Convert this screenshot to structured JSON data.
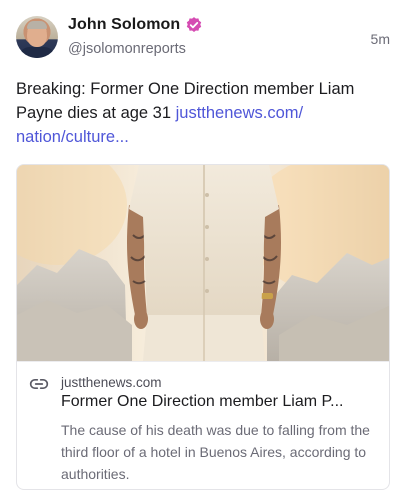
{
  "post": {
    "author_name": "John Solomon",
    "handle": "@jsolomonreports",
    "time": "5m",
    "text_prefix": "Breaking: Former One Direction member Liam Payne dies at age 31 ",
    "link_text": "justthenews.com/ nation/culture..."
  },
  "card": {
    "domain": "justthenews.com",
    "title": "Former One Direction member Liam P...",
    "description": "The cause of his death was due to falling from the third floor of a hotel in Buenos Aires, according to authorities."
  },
  "icons": {
    "verified": "verified-badge-icon",
    "link": "link-icon"
  },
  "colors": {
    "link": "#4f56d8",
    "verified": "#d54bb2",
    "muted_text": "#6b6b76"
  }
}
